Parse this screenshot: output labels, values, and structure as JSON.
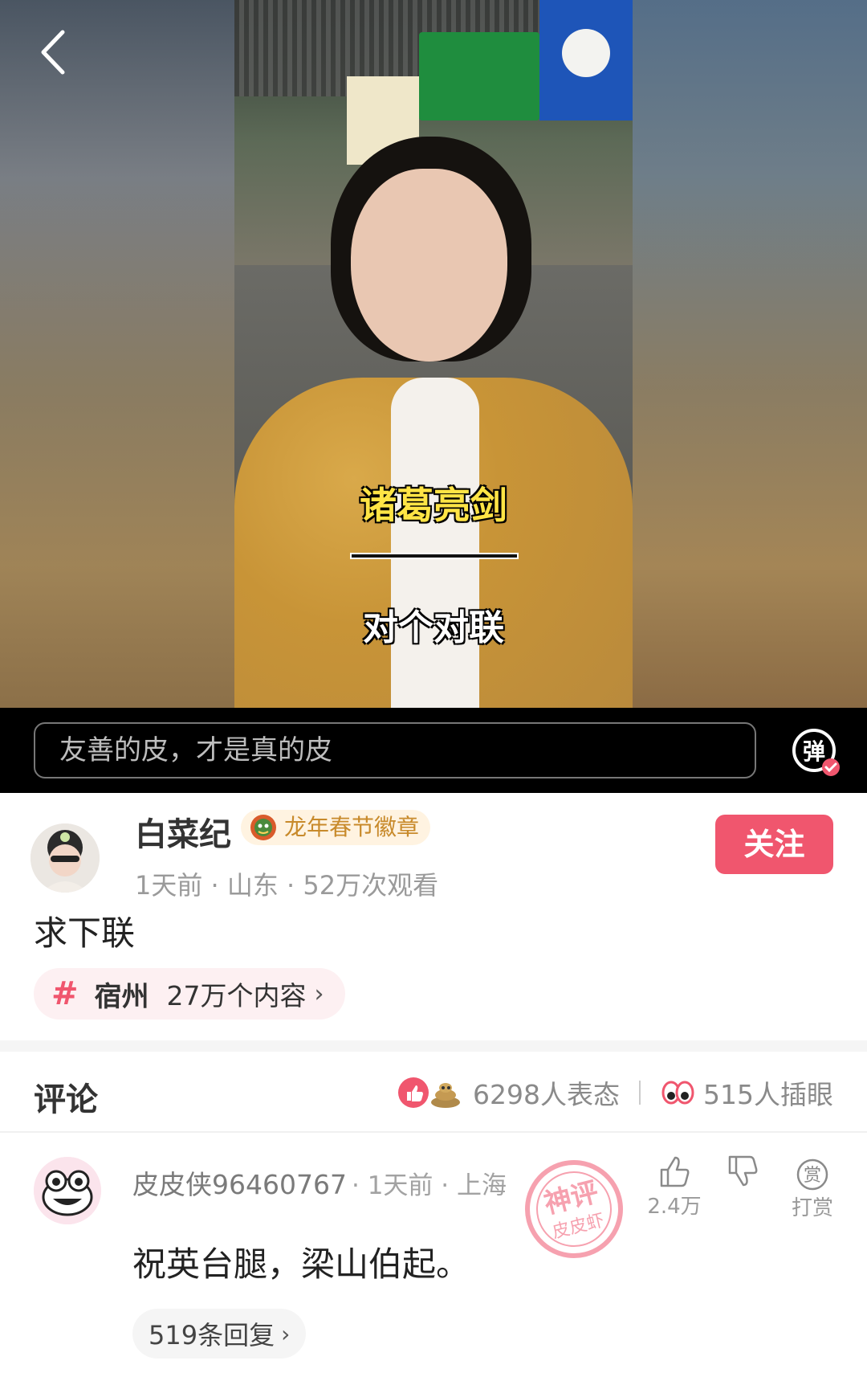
{
  "video": {
    "caption_top": "诸葛亮剑",
    "caption_bottom": "对个对联"
  },
  "danmaku": {
    "placeholder": "友善的皮，才是真的皮",
    "toggle_label": "弹"
  },
  "post": {
    "author_name": "白菜纪",
    "badge_label": "龙年春节徽章",
    "follow_label": "关注",
    "meta": "1天前 · 山东 · 52万次观看",
    "text": "求下联",
    "topic": {
      "hash": "#",
      "name": "宿州",
      "count": "27万个内容",
      "chevron": "›"
    }
  },
  "comments_header": {
    "title": "评论",
    "reactions_text": "6298人表态",
    "eyes_text": "515人插眼"
  },
  "comment": {
    "user": "皮皮侠96460767",
    "meta": "· 1天前 · 上海",
    "stamp_top": "神评",
    "stamp_bottom": "皮皮虾",
    "like_count": "2.4万",
    "reward_label": "打赏",
    "reward_icon_text": "赏",
    "text": "祝英台腿，梁山伯起。",
    "replies_label": "519条回复",
    "replies_chevron": "›"
  },
  "colors": {
    "accent": "#f0566e",
    "badge_text": "#c88a2b",
    "chip_bg": "#fdf0f2"
  }
}
